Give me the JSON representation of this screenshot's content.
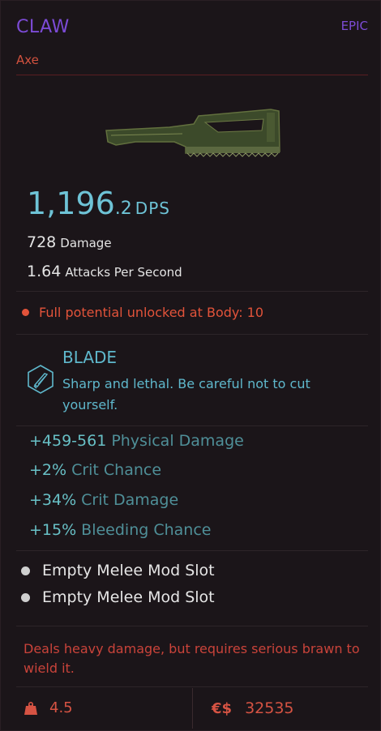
{
  "item": {
    "name": "CLAW",
    "rarity": "EPIC",
    "type": "Axe"
  },
  "stats": {
    "dps_whole": "1,196",
    "dps_decimal": ".2",
    "dps_unit": "DPS",
    "damage_value": "728",
    "damage_label": "Damage",
    "aps_value": "1.64",
    "aps_label": "Attacks Per Second"
  },
  "requirement": {
    "text": "Full potential unlocked at Body: 10"
  },
  "mod": {
    "icon": "blade-icon",
    "name": "BLADE",
    "description": "Sharp and lethal. Be careful not to cut yourself."
  },
  "bonuses": [
    {
      "value": "+459-561",
      "label": "Physical Damage"
    },
    {
      "value": "+2%",
      "label": "Crit Chance"
    },
    {
      "value": "+34%",
      "label": "Crit Damage"
    },
    {
      "value": "+15%",
      "label": "Bleeding Chance"
    }
  ],
  "slots": [
    {
      "label": "Empty Melee Mod Slot"
    },
    {
      "label": "Empty Melee Mod Slot"
    }
  ],
  "flavor": "Deals heavy damage, but requires serious brawn to wield it.",
  "footer": {
    "weight_icon": "weight-icon",
    "weight": "4.5",
    "currency_symbol": "€$",
    "price": "32535"
  },
  "colors": {
    "rarity_epic": "#7c4bd6",
    "accent_red": "#d65343",
    "accent_cyan": "#6ec3d6"
  }
}
